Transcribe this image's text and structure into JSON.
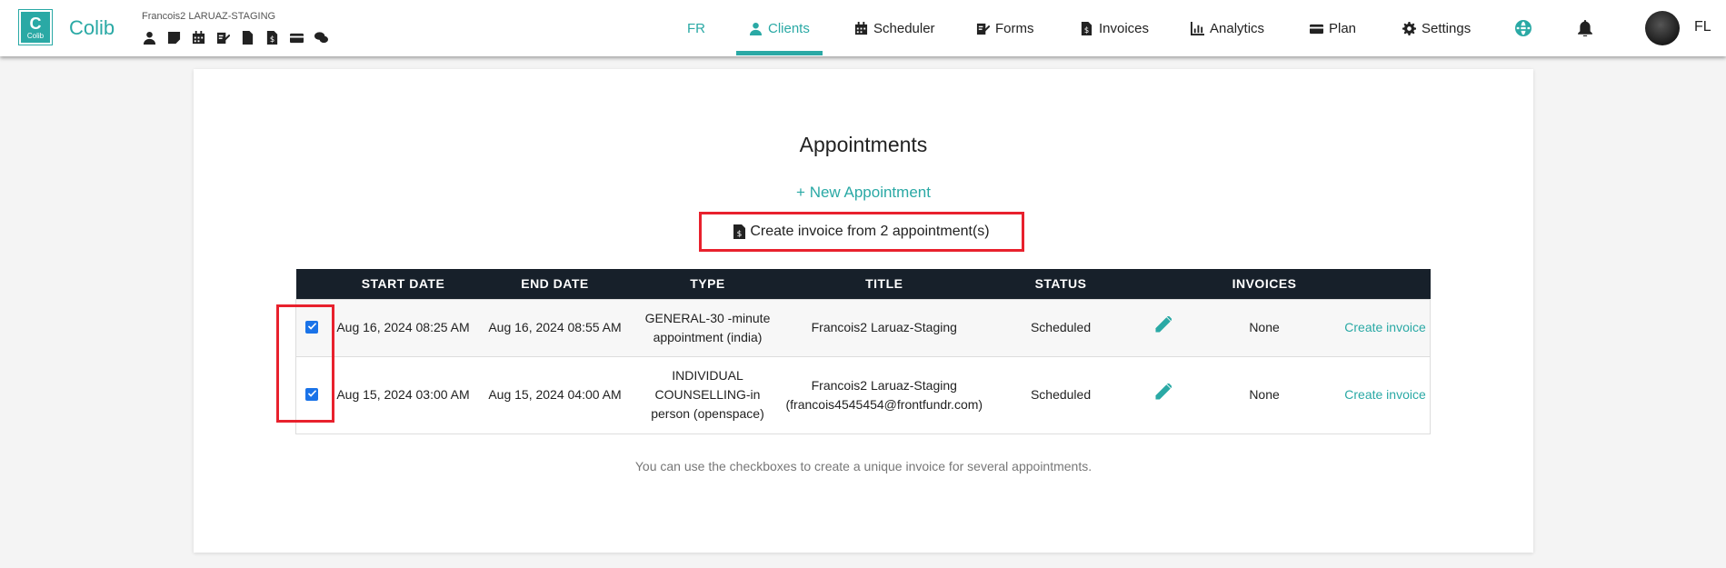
{
  "app": {
    "logo_letter": "C",
    "logo_small": "Colib",
    "brand": "Colib",
    "account_name": "Francois2 LARUAZ-STAGING"
  },
  "quick_icons": [
    "user-icon",
    "note-icon",
    "calendar-icon",
    "form-icon",
    "document-icon",
    "invoice-icon",
    "credit-card-icon",
    "chat-icon"
  ],
  "nav": {
    "lang": "FR",
    "items": [
      {
        "label": "Clients",
        "icon": "user-icon",
        "active": true
      },
      {
        "label": "Scheduler",
        "icon": "calendar-icon"
      },
      {
        "label": "Forms",
        "icon": "form-icon"
      },
      {
        "label": "Invoices",
        "icon": "invoice-icon"
      },
      {
        "label": "Analytics",
        "icon": "chart-icon"
      },
      {
        "label": "Plan",
        "icon": "credit-card-icon"
      },
      {
        "label": "Settings",
        "icon": "gear-icon"
      }
    ],
    "initials": "FL",
    "accent": "#2aa9a5"
  },
  "main": {
    "title": "Appointments",
    "new_appointment": "New Appointment",
    "create_multi": "Create invoice from 2 appointment(s)",
    "hint": "You can use the checkboxes to create a unique invoice for several appointments."
  },
  "table": {
    "headers": [
      "START DATE",
      "END DATE",
      "TYPE",
      "TITLE",
      "STATUS",
      "",
      "INVOICES",
      ""
    ],
    "rows": [
      {
        "checked": true,
        "start": "Aug 16, 2024 08:25 AM",
        "end": "Aug 16, 2024 08:55 AM",
        "type": "GENERAL-30 -minute appointment (india)",
        "title": "Francois2 Laruaz-Staging",
        "status": "Scheduled",
        "invoices": "None",
        "action": "Create invoice"
      },
      {
        "checked": true,
        "start": "Aug 15, 2024 03:00 AM",
        "end": "Aug 15, 2024 04:00 AM",
        "type": "INDIVIDUAL COUNSELLING-in person (openspace)",
        "title": "Francois2 Laruaz-Staging (francois4545454@frontfundr.com)",
        "status": "Scheduled",
        "invoices": "None",
        "action": "Create invoice"
      }
    ]
  }
}
